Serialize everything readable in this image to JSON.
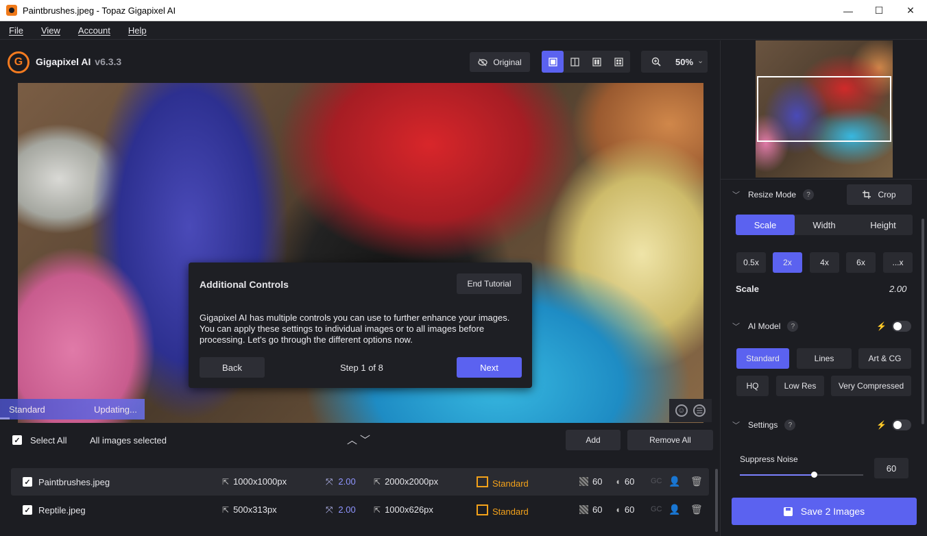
{
  "window": {
    "title": "Paintbrushes.jpeg - Topaz Gigapixel AI",
    "controls": {
      "minimize": "—",
      "maximize": "☐",
      "close": "✕"
    }
  },
  "menu": [
    "File",
    "View",
    "Account",
    "Help"
  ],
  "brand": {
    "name": "Gigapixel AI",
    "version": "v6.3.3"
  },
  "toolbar": {
    "original_label": "Original",
    "zoom": "50%",
    "view_modes": [
      "single-view",
      "split-vertical",
      "side-by-side",
      "quad-view"
    ],
    "active_view": "single-view"
  },
  "preview": {
    "status_label": "Standard",
    "status_text": "Updating..."
  },
  "tutorial": {
    "title": "Additional Controls",
    "end_label": "End Tutorial",
    "body": "Gigapixel AI has multiple controls you can use to further enhance your images. You can apply these settings to individual images or to all images before processing. Let's go through the different options now.",
    "back_label": "Back",
    "step": "Step 1 of 8",
    "next_label": "Next"
  },
  "list": {
    "select_all": "Select All",
    "selected_text": "All images selected",
    "add_label": "Add",
    "remove_all_label": "Remove All",
    "files": [
      {
        "name": "Paintbrushes.jpeg",
        "input_size": "1000x1000px",
        "scale": "2.00",
        "output_size": "2000x2000px",
        "model": "Standard",
        "noise": "60",
        "blur": "60",
        "gc": "GC",
        "selected": true
      },
      {
        "name": "Reptile.jpeg",
        "input_size": "500x313px",
        "scale": "2.00",
        "output_size": "1000x626px",
        "model": "Standard",
        "noise": "60",
        "blur": "60",
        "gc": "GC",
        "selected": false
      }
    ]
  },
  "panel": {
    "resize_mode": {
      "title": "Resize Mode",
      "help": "?",
      "crop_label": "Crop",
      "tabs": [
        "Scale",
        "Width",
        "Height"
      ],
      "active_tab": "Scale",
      "scales": [
        "0.5x",
        "2x",
        "4x",
        "6x",
        "...x"
      ],
      "active_scale": "2x",
      "scale_label": "Scale",
      "scale_value": "2.00"
    },
    "ai_model": {
      "title": "AI Model",
      "help": "?",
      "row1": [
        "Standard",
        "Lines",
        "Art & CG"
      ],
      "row2": [
        "HQ",
        "Low Res",
        "Very Compressed"
      ],
      "active": "Standard",
      "toggle_on": false
    },
    "settings": {
      "title": "Settings",
      "help": "?",
      "toggle_on": false,
      "suppress_noise_label": "Suppress Noise",
      "suppress_noise_value": "60",
      "suppress_noise_fraction": 0.6
    },
    "save_label": "Save 2 Images"
  },
  "colors": {
    "accent": "#5b62f0",
    "model": "#f4a21a",
    "scale_text": "#8f95ff"
  }
}
